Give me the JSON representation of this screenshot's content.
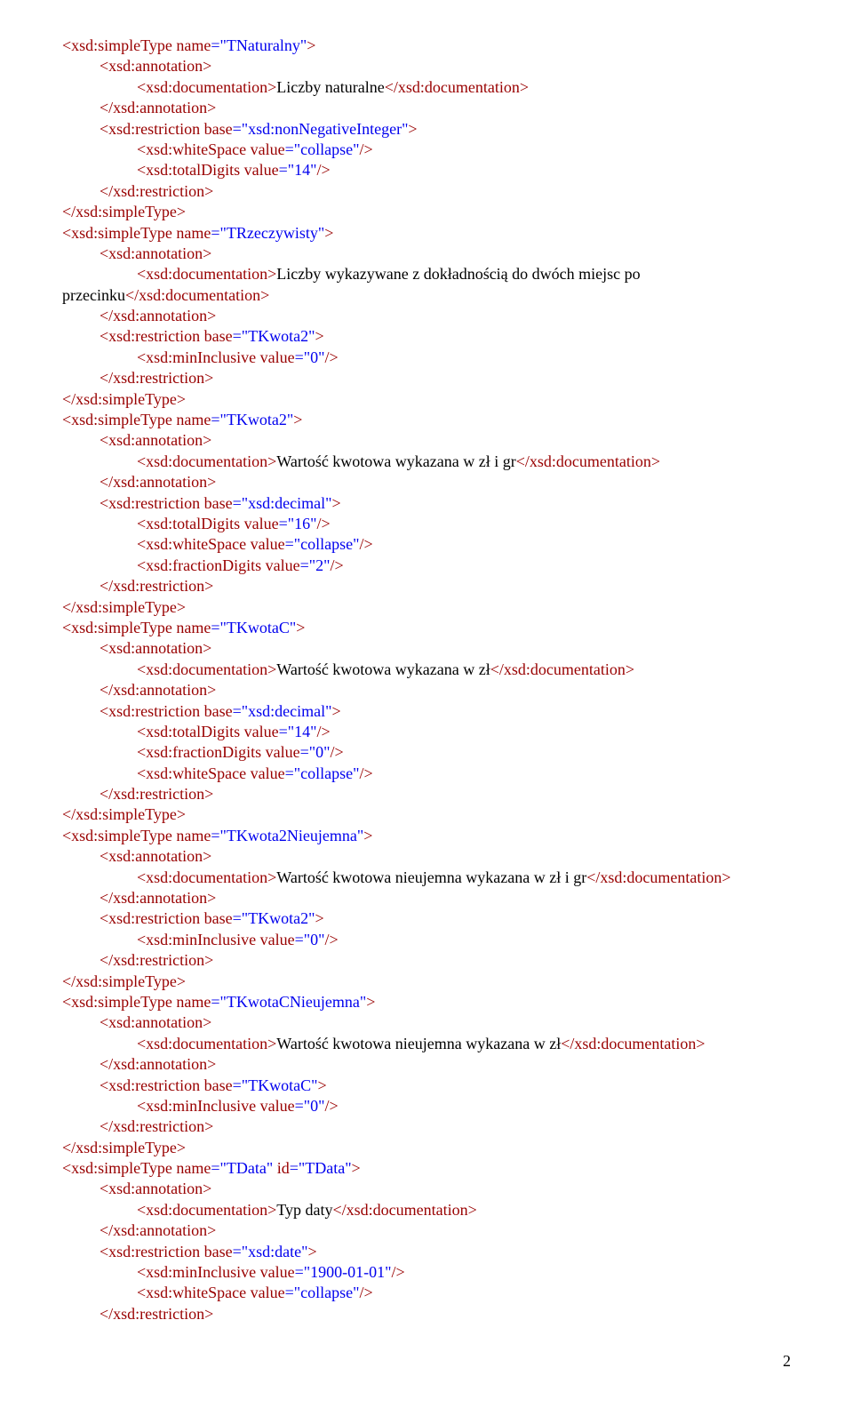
{
  "lines": [
    {
      "indent": 0,
      "segs": [
        {
          "c": "maroon",
          "t": "<xsd:simpleType name"
        },
        {
          "c": "blue",
          "t": "=\"TNaturalny\""
        },
        {
          "c": "maroon",
          "t": ">"
        }
      ]
    },
    {
      "indent": 1,
      "segs": [
        {
          "c": "maroon",
          "t": "<xsd:annotation>"
        }
      ]
    },
    {
      "indent": 2,
      "segs": [
        {
          "c": "maroon",
          "t": "<xsd:documentation>"
        },
        {
          "c": "black",
          "t": "Liczby naturalne"
        },
        {
          "c": "maroon",
          "t": "</xsd:documentation>"
        }
      ]
    },
    {
      "indent": 1,
      "segs": [
        {
          "c": "maroon",
          "t": "</xsd:annotation>"
        }
      ]
    },
    {
      "indent": 1,
      "segs": [
        {
          "c": "maroon",
          "t": "<xsd:restriction base"
        },
        {
          "c": "blue",
          "t": "=\"xsd:nonNegativeInteger\""
        },
        {
          "c": "maroon",
          "t": ">"
        }
      ]
    },
    {
      "indent": 2,
      "segs": [
        {
          "c": "maroon",
          "t": "<xsd:whiteSpace value"
        },
        {
          "c": "blue",
          "t": "=\"collapse\""
        },
        {
          "c": "maroon",
          "t": "/>"
        }
      ]
    },
    {
      "indent": 2,
      "segs": [
        {
          "c": "maroon",
          "t": "<xsd:totalDigits value"
        },
        {
          "c": "blue",
          "t": "=\"14\""
        },
        {
          "c": "maroon",
          "t": "/>"
        }
      ]
    },
    {
      "indent": 1,
      "segs": [
        {
          "c": "maroon",
          "t": "</xsd:restriction>"
        }
      ]
    },
    {
      "indent": 0,
      "segs": [
        {
          "c": "maroon",
          "t": "</xsd:simpleType>"
        }
      ]
    },
    {
      "indent": 0,
      "segs": [
        {
          "c": "maroon",
          "t": "<xsd:simpleType name"
        },
        {
          "c": "blue",
          "t": "=\"TRzeczywisty\""
        },
        {
          "c": "maroon",
          "t": ">"
        }
      ]
    },
    {
      "indent": 1,
      "segs": [
        {
          "c": "maroon",
          "t": "<xsd:annotation>"
        }
      ]
    },
    {
      "indent": 2,
      "segs": [
        {
          "c": "maroon",
          "t": "<xsd:documentation>"
        },
        {
          "c": "black",
          "t": "Liczby wykazywane z dokładnością do dwóch miejsc po"
        }
      ]
    },
    {
      "indent": -1,
      "segs": [
        {
          "c": "black",
          "t": "przecinku"
        },
        {
          "c": "maroon",
          "t": "</xsd:documentation>"
        }
      ]
    },
    {
      "indent": 1,
      "segs": [
        {
          "c": "maroon",
          "t": "</xsd:annotation>"
        }
      ]
    },
    {
      "indent": 1,
      "segs": [
        {
          "c": "maroon",
          "t": "<xsd:restriction base"
        },
        {
          "c": "blue",
          "t": "=\"TKwota2\""
        },
        {
          "c": "maroon",
          "t": ">"
        }
      ]
    },
    {
      "indent": 2,
      "segs": [
        {
          "c": "maroon",
          "t": "<xsd:minInclusive value"
        },
        {
          "c": "blue",
          "t": "=\"0\""
        },
        {
          "c": "maroon",
          "t": "/>"
        }
      ]
    },
    {
      "indent": 1,
      "segs": [
        {
          "c": "maroon",
          "t": "</xsd:restriction>"
        }
      ]
    },
    {
      "indent": 0,
      "segs": [
        {
          "c": "maroon",
          "t": "</xsd:simpleType>"
        }
      ]
    },
    {
      "indent": 0,
      "segs": [
        {
          "c": "maroon",
          "t": "<xsd:simpleType name"
        },
        {
          "c": "blue",
          "t": "=\"TKwota2\""
        },
        {
          "c": "maroon",
          "t": ">"
        }
      ]
    },
    {
      "indent": 1,
      "segs": [
        {
          "c": "maroon",
          "t": "<xsd:annotation>"
        }
      ]
    },
    {
      "indent": 2,
      "segs": [
        {
          "c": "maroon",
          "t": "<xsd:documentation>"
        },
        {
          "c": "black",
          "t": "Wartość kwotowa wykazana w zł i gr"
        },
        {
          "c": "maroon",
          "t": "</xsd:documentation>"
        }
      ]
    },
    {
      "indent": 1,
      "segs": [
        {
          "c": "maroon",
          "t": "</xsd:annotation>"
        }
      ]
    },
    {
      "indent": 1,
      "segs": [
        {
          "c": "maroon",
          "t": "<xsd:restriction base"
        },
        {
          "c": "blue",
          "t": "=\"xsd:decimal\""
        },
        {
          "c": "maroon",
          "t": ">"
        }
      ]
    },
    {
      "indent": 2,
      "segs": [
        {
          "c": "maroon",
          "t": "<xsd:totalDigits value"
        },
        {
          "c": "blue",
          "t": "=\"16\""
        },
        {
          "c": "maroon",
          "t": "/>"
        }
      ]
    },
    {
      "indent": 2,
      "segs": [
        {
          "c": "maroon",
          "t": "<xsd:whiteSpace value"
        },
        {
          "c": "blue",
          "t": "=\"collapse\""
        },
        {
          "c": "maroon",
          "t": "/>"
        }
      ]
    },
    {
      "indent": 2,
      "segs": [
        {
          "c": "maroon",
          "t": "<xsd:fractionDigits value"
        },
        {
          "c": "blue",
          "t": "=\"2\""
        },
        {
          "c": "maroon",
          "t": "/>"
        }
      ]
    },
    {
      "indent": 1,
      "segs": [
        {
          "c": "maroon",
          "t": "</xsd:restriction>"
        }
      ]
    },
    {
      "indent": 0,
      "segs": [
        {
          "c": "maroon",
          "t": "</xsd:simpleType>"
        }
      ]
    },
    {
      "indent": 0,
      "segs": [
        {
          "c": "maroon",
          "t": "<xsd:simpleType name"
        },
        {
          "c": "blue",
          "t": "=\"TKwotaC\""
        },
        {
          "c": "maroon",
          "t": ">"
        }
      ]
    },
    {
      "indent": 1,
      "segs": [
        {
          "c": "maroon",
          "t": "<xsd:annotation>"
        }
      ]
    },
    {
      "indent": 2,
      "segs": [
        {
          "c": "maroon",
          "t": "<xsd:documentation>"
        },
        {
          "c": "black",
          "t": "Wartość kwotowa wykazana w zł"
        },
        {
          "c": "maroon",
          "t": "</xsd:documentation>"
        }
      ]
    },
    {
      "indent": 1,
      "segs": [
        {
          "c": "maroon",
          "t": "</xsd:annotation>"
        }
      ]
    },
    {
      "indent": 1,
      "segs": [
        {
          "c": "maroon",
          "t": "<xsd:restriction base"
        },
        {
          "c": "blue",
          "t": "=\"xsd:decimal\""
        },
        {
          "c": "maroon",
          "t": ">"
        }
      ]
    },
    {
      "indent": 2,
      "segs": [
        {
          "c": "maroon",
          "t": "<xsd:totalDigits value"
        },
        {
          "c": "blue",
          "t": "=\"14\""
        },
        {
          "c": "maroon",
          "t": "/>"
        }
      ]
    },
    {
      "indent": 2,
      "segs": [
        {
          "c": "maroon",
          "t": "<xsd:fractionDigits value"
        },
        {
          "c": "blue",
          "t": "=\"0\""
        },
        {
          "c": "maroon",
          "t": "/>"
        }
      ]
    },
    {
      "indent": 2,
      "segs": [
        {
          "c": "maroon",
          "t": "<xsd:whiteSpace value"
        },
        {
          "c": "blue",
          "t": "=\"collapse\""
        },
        {
          "c": "maroon",
          "t": "/>"
        }
      ]
    },
    {
      "indent": 1,
      "segs": [
        {
          "c": "maroon",
          "t": "</xsd:restriction>"
        }
      ]
    },
    {
      "indent": 0,
      "segs": [
        {
          "c": "maroon",
          "t": "</xsd:simpleType>"
        }
      ]
    },
    {
      "indent": 0,
      "segs": [
        {
          "c": "maroon",
          "t": "<xsd:simpleType name"
        },
        {
          "c": "blue",
          "t": "=\"TKwota2Nieujemna\""
        },
        {
          "c": "maroon",
          "t": ">"
        }
      ]
    },
    {
      "indent": 1,
      "segs": [
        {
          "c": "maroon",
          "t": "<xsd:annotation>"
        }
      ]
    },
    {
      "indent": 2,
      "segs": [
        {
          "c": "maroon",
          "t": "<xsd:documentation>"
        },
        {
          "c": "black",
          "t": "Wartość kwotowa nieujemna wykazana w zł i gr"
        },
        {
          "c": "maroon",
          "t": "</xsd:documentation>"
        }
      ]
    },
    {
      "indent": 1,
      "segs": [
        {
          "c": "maroon",
          "t": "</xsd:annotation>"
        }
      ]
    },
    {
      "indent": 1,
      "segs": [
        {
          "c": "maroon",
          "t": "<xsd:restriction base"
        },
        {
          "c": "blue",
          "t": "=\"TKwota2\""
        },
        {
          "c": "maroon",
          "t": ">"
        }
      ]
    },
    {
      "indent": 2,
      "segs": [
        {
          "c": "maroon",
          "t": "<xsd:minInclusive value"
        },
        {
          "c": "blue",
          "t": "=\"0\""
        },
        {
          "c": "maroon",
          "t": "/>"
        }
      ]
    },
    {
      "indent": 1,
      "segs": [
        {
          "c": "maroon",
          "t": "</xsd:restriction>"
        }
      ]
    },
    {
      "indent": 0,
      "segs": [
        {
          "c": "maroon",
          "t": "</xsd:simpleType>"
        }
      ]
    },
    {
      "indent": 0,
      "segs": [
        {
          "c": "maroon",
          "t": "<xsd:simpleType name"
        },
        {
          "c": "blue",
          "t": "=\"TKwotaCNieujemna\""
        },
        {
          "c": "maroon",
          "t": ">"
        }
      ]
    },
    {
      "indent": 1,
      "segs": [
        {
          "c": "maroon",
          "t": "<xsd:annotation>"
        }
      ]
    },
    {
      "indent": 2,
      "segs": [
        {
          "c": "maroon",
          "t": "<xsd:documentation>"
        },
        {
          "c": "black",
          "t": "Wartość kwotowa nieujemna wykazana w zł"
        },
        {
          "c": "maroon",
          "t": "</xsd:documentation>"
        }
      ]
    },
    {
      "indent": 1,
      "segs": [
        {
          "c": "maroon",
          "t": "</xsd:annotation>"
        }
      ]
    },
    {
      "indent": 1,
      "segs": [
        {
          "c": "maroon",
          "t": "<xsd:restriction base"
        },
        {
          "c": "blue",
          "t": "=\"TKwotaC\""
        },
        {
          "c": "maroon",
          "t": ">"
        }
      ]
    },
    {
      "indent": 2,
      "segs": [
        {
          "c": "maroon",
          "t": "<xsd:minInclusive value"
        },
        {
          "c": "blue",
          "t": "=\"0\""
        },
        {
          "c": "maroon",
          "t": "/>"
        }
      ]
    },
    {
      "indent": 1,
      "segs": [
        {
          "c": "maroon",
          "t": "</xsd:restriction>"
        }
      ]
    },
    {
      "indent": 0,
      "segs": [
        {
          "c": "maroon",
          "t": "</xsd:simpleType>"
        }
      ]
    },
    {
      "indent": 0,
      "segs": [
        {
          "c": "maroon",
          "t": "<xsd:simpleType name"
        },
        {
          "c": "blue",
          "t": "=\"TData\""
        },
        {
          "c": "maroon",
          "t": " id"
        },
        {
          "c": "blue",
          "t": "=\"TData\""
        },
        {
          "c": "maroon",
          "t": ">"
        }
      ]
    },
    {
      "indent": 1,
      "segs": [
        {
          "c": "maroon",
          "t": "<xsd:annotation>"
        }
      ]
    },
    {
      "indent": 2,
      "segs": [
        {
          "c": "maroon",
          "t": "<xsd:documentation>"
        },
        {
          "c": "black",
          "t": "Typ daty"
        },
        {
          "c": "maroon",
          "t": "</xsd:documentation>"
        }
      ]
    },
    {
      "indent": 1,
      "segs": [
        {
          "c": "maroon",
          "t": "</xsd:annotation>"
        }
      ]
    },
    {
      "indent": 1,
      "segs": [
        {
          "c": "maroon",
          "t": "<xsd:restriction base"
        },
        {
          "c": "blue",
          "t": "=\"xsd:date\""
        },
        {
          "c": "maroon",
          "t": ">"
        }
      ]
    },
    {
      "indent": 2,
      "segs": [
        {
          "c": "maroon",
          "t": "<xsd:minInclusive value"
        },
        {
          "c": "blue",
          "t": "=\"1900-01-01\""
        },
        {
          "c": "maroon",
          "t": "/>"
        }
      ]
    },
    {
      "indent": 2,
      "segs": [
        {
          "c": "maroon",
          "t": "<xsd:whiteSpace value"
        },
        {
          "c": "blue",
          "t": "=\"collapse\""
        },
        {
          "c": "maroon",
          "t": "/>"
        }
      ]
    },
    {
      "indent": 1,
      "segs": [
        {
          "c": "maroon",
          "t": "</xsd:restriction>"
        }
      ]
    }
  ],
  "pageNumber": "2"
}
